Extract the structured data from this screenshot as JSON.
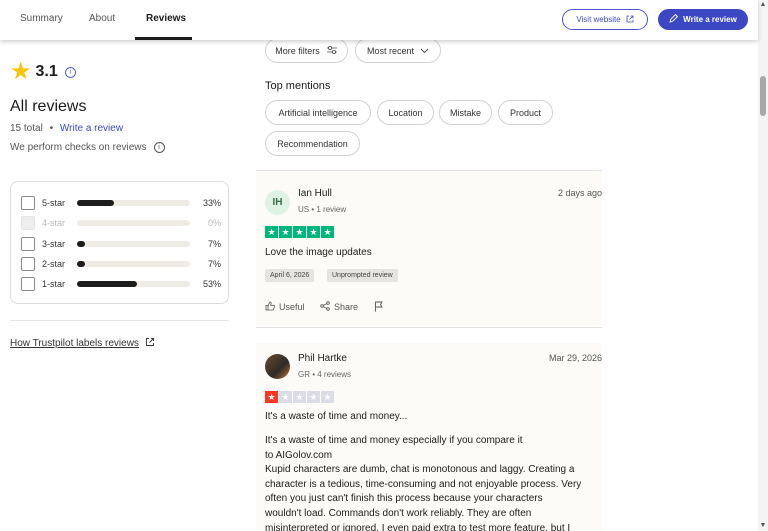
{
  "nav": {
    "tabs": [
      {
        "label": "Summary"
      },
      {
        "label": "About"
      },
      {
        "label": "Reviews"
      }
    ],
    "visit_website": "Visit website",
    "write_review": "Write a review"
  },
  "summary": {
    "rating": "3.1",
    "heading": "All reviews",
    "total": "15 total",
    "separator": "•",
    "write_link": "Write a review",
    "checks": "We perform checks on reviews",
    "distribution": [
      {
        "label": "5-star",
        "percent": "33%",
        "fraction": 0.33,
        "disabled": false
      },
      {
        "label": "4-star",
        "percent": "0%",
        "fraction": 0,
        "disabled": true
      },
      {
        "label": "3-star",
        "percent": "7%",
        "fraction": 0.07,
        "disabled": false
      },
      {
        "label": "2-star",
        "percent": "7%",
        "fraction": 0.07,
        "disabled": false
      },
      {
        "label": "1-star",
        "percent": "53%",
        "fraction": 0.53,
        "disabled": false
      }
    ],
    "labels_link": "How Trustpilot labels reviews"
  },
  "filters": {
    "more_filters": "More filters",
    "sort": "Most recent"
  },
  "mentions": {
    "title": "Top mentions",
    "items": [
      "Artificial intelligence",
      "Location",
      "Mistake",
      "Product",
      "Recommendation"
    ]
  },
  "reviews": [
    {
      "initials": "IH",
      "name": "Ian Hull",
      "meta": "US • 1 review",
      "date": "2 days ago",
      "rating": 5,
      "title": "Love the image updates",
      "tags": [
        "April 6, 2026",
        "Unprompted review"
      ],
      "useful": "Useful",
      "share": "Share"
    },
    {
      "initials": "",
      "name": "Phil Hartke",
      "meta": "GR • 4 reviews",
      "date": "Mar 29, 2026",
      "rating": 1,
      "title": "It's a waste of time and money...",
      "body": "It's a waste of time and money especially if you compare it\nto AIGolov.com\nKupid characters are dumb, chat is monotonous and laggy. Creating a\ncharacter is a tedious, time-consuming and not enjoyable process. Very\noften you just can't finish this process because your characters\nwouldn't load. Commands don't work reliably. They are often\nmisinterpreted or ignored. I even paid extra to test more feature, but I"
    }
  ]
}
